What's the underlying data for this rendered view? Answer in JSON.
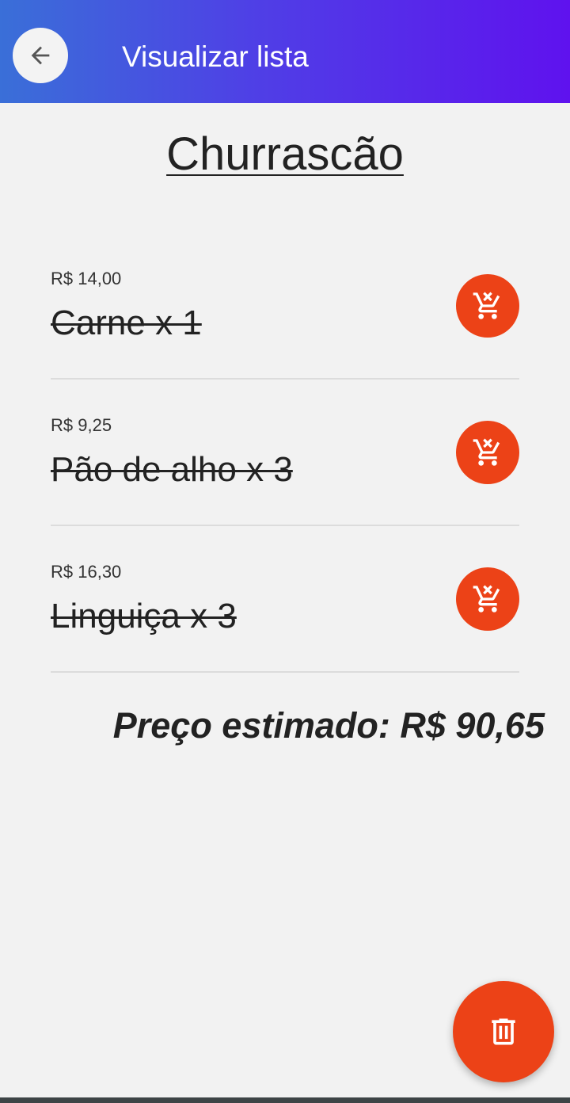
{
  "appbar": {
    "title": "Visualizar lista",
    "back_icon": "arrow-left-icon",
    "gradient_start": "#3a6fd8",
    "gradient_end": "#5f12ee"
  },
  "list": {
    "name": "Churrascão",
    "items": [
      {
        "price": "R$ 14,00",
        "name": "Carne x 1",
        "action_icon": "remove-from-cart-icon"
      },
      {
        "price": "R$ 9,25",
        "name": "Pão de alho x 3",
        "action_icon": "remove-from-cart-icon"
      },
      {
        "price": "R$ 16,30",
        "name": "Linguiça x 3",
        "action_icon": "remove-from-cart-icon"
      }
    ]
  },
  "total_label": "Preço estimado: R$ 90,65",
  "fab": {
    "icon": "trash-icon"
  },
  "colors": {
    "accent": "#ec4217",
    "background": "#f2f2f2",
    "text": "#222222"
  }
}
